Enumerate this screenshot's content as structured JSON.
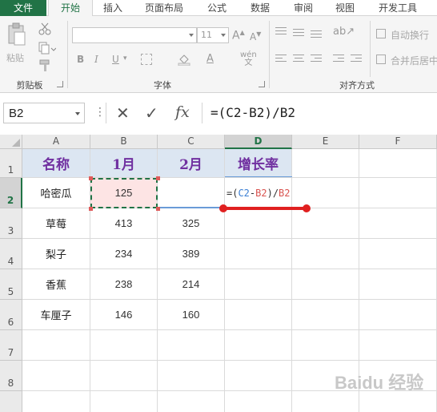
{
  "tabs": [
    "文件",
    "开始",
    "插入",
    "页面布局",
    "公式",
    "数据",
    "审阅",
    "视图",
    "开发工具"
  ],
  "ribbon": {
    "clipboard": {
      "paste": "粘贴",
      "group": "剪贴板"
    },
    "font": {
      "size": "11",
      "bold": "B",
      "italic": "I",
      "underline": "U",
      "fontcolor": "A",
      "phonetic": "wén",
      "group": "字体"
    },
    "align": {
      "wrap": "自动换行",
      "merge": "合并后居中",
      "group": "对齐方式"
    }
  },
  "formula_bar": {
    "name_box": "B2",
    "formula": "=(C2-B2)/B2",
    "cancel": "✕",
    "enter": "✓",
    "fx": "fx"
  },
  "grid": {
    "columns": [
      "A",
      "B",
      "C",
      "D",
      "E",
      "F"
    ],
    "rows": [
      "1",
      "2",
      "3",
      "4",
      "5",
      "6",
      "7",
      "8"
    ],
    "headers": [
      "名称",
      "1月",
      "2月",
      "增长率"
    ],
    "data": [
      {
        "name": "哈密瓜",
        "jan": "125",
        "feb": ""
      },
      {
        "name": "草莓",
        "jan": "413",
        "feb": "325"
      },
      {
        "name": "梨子",
        "jan": "234",
        "feb": "389"
      },
      {
        "name": "香蕉",
        "jan": "238",
        "feb": "214"
      },
      {
        "name": "车厘子",
        "jan": "146",
        "feb": "160"
      }
    ],
    "editing": {
      "prefix": "=(",
      "ref1": "C2",
      "minus": "-",
      "ref2": "B2",
      "mid": ")/",
      "ref3": "B2"
    }
  },
  "watermark": "Baidu 经验",
  "colors": {
    "accent": "#217346",
    "header_fill": "#dce6f2",
    "header_text": "#7030a0",
    "arrow": "#e02020"
  }
}
